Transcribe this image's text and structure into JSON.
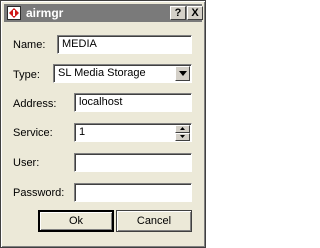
{
  "window": {
    "title": "airmgr",
    "help_label": "?",
    "close_label": "X"
  },
  "form": {
    "name": {
      "label": "Name:",
      "value": "MEDIA"
    },
    "type": {
      "label": "Type:",
      "selected": "SL Media Storage"
    },
    "address": {
      "label": "Address:",
      "value": "localhost"
    },
    "service": {
      "label": "Service:",
      "value": "1"
    },
    "user": {
      "label": "User:",
      "value": ""
    },
    "password": {
      "label": "Password:",
      "value": ""
    }
  },
  "buttons": {
    "ok_label": "Ok",
    "cancel_label": "Cancel"
  },
  "icons": {
    "app": "app-icon",
    "help": "help-icon",
    "close": "close-icon",
    "dropdown": "chevron-down-icon",
    "spin_up": "spin-up-icon",
    "spin_down": "spin-down-icon"
  },
  "colors": {
    "titlebar": "#7a7a7a",
    "dialog_bg": "#ece9d8",
    "app_icon_accent": "#d01818"
  }
}
